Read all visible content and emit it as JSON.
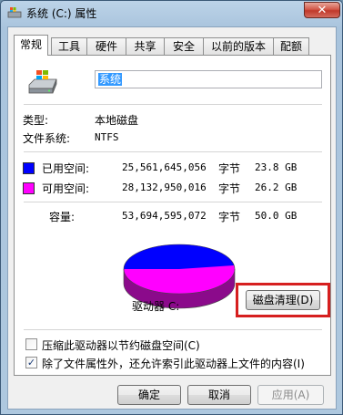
{
  "window": {
    "title": "系统 (C:) 属性",
    "close_glyph": "✕"
  },
  "tabs": [
    {
      "label": "常规",
      "active": true
    },
    {
      "label": "工具",
      "active": false
    },
    {
      "label": "硬件",
      "active": false
    },
    {
      "label": "共享",
      "active": false
    },
    {
      "label": "安全",
      "active": false
    },
    {
      "label": "以前的版本",
      "active": false
    },
    {
      "label": "配额",
      "active": false
    }
  ],
  "general": {
    "volume_name": "系统",
    "type_label": "类型:",
    "type_value": "本地磁盘",
    "fs_label": "文件系统:",
    "fs_value": "NTFS",
    "used": {
      "label": "已用空间:",
      "bytes": "25,561,645,056",
      "unit": "字节",
      "size": "23.8 GB",
      "color": "#0000ff"
    },
    "free": {
      "label": "可用空间:",
      "bytes": "28,132,950,016",
      "unit": "字节",
      "size": "26.2 GB",
      "color": "#ff00ff"
    },
    "capacity": {
      "label": "容量:",
      "bytes": "53,694,595,072",
      "unit": "字节",
      "size": "50.0 GB"
    },
    "drive_label": "驱动器 C:",
    "cleanup_button": "磁盘清理(D)",
    "used_fraction": 0.476
  },
  "options": {
    "compress": {
      "label": "压缩此驱动器以节约磁盘空间(C)",
      "checked": false
    },
    "index": {
      "label": "除了文件属性外，还允许索引此驱动器上文件的内容(I)",
      "checked": true
    }
  },
  "footer": {
    "ok": "确定",
    "cancel": "取消",
    "apply": "应用(A)"
  }
}
